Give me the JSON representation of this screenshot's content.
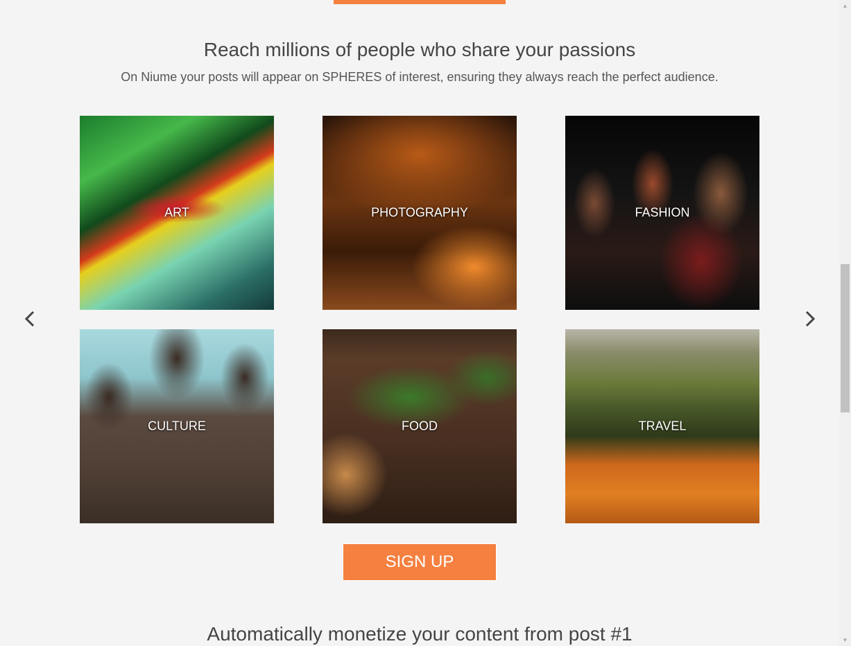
{
  "hero": {
    "title": "Reach millions of people who share your passions",
    "subtitle": "On Niume your posts will appear on SPHERES of interest, ensuring they always reach the perfect audience."
  },
  "spheres": [
    {
      "label": "ART"
    },
    {
      "label": "PHOTOGRAPHY"
    },
    {
      "label": "FASHION"
    },
    {
      "label": "CULTURE"
    },
    {
      "label": "FOOD"
    },
    {
      "label": "TRAVEL"
    }
  ],
  "carousel": {
    "prev_icon": "chevron-left-icon",
    "next_icon": "chevron-right-icon"
  },
  "cta": {
    "signup_label": "SIGN UP"
  },
  "section2": {
    "title": "Automatically monetize your content from post #1"
  },
  "colors": {
    "accent": "#f58040",
    "background": "#f4f4f4",
    "text": "#444444"
  }
}
